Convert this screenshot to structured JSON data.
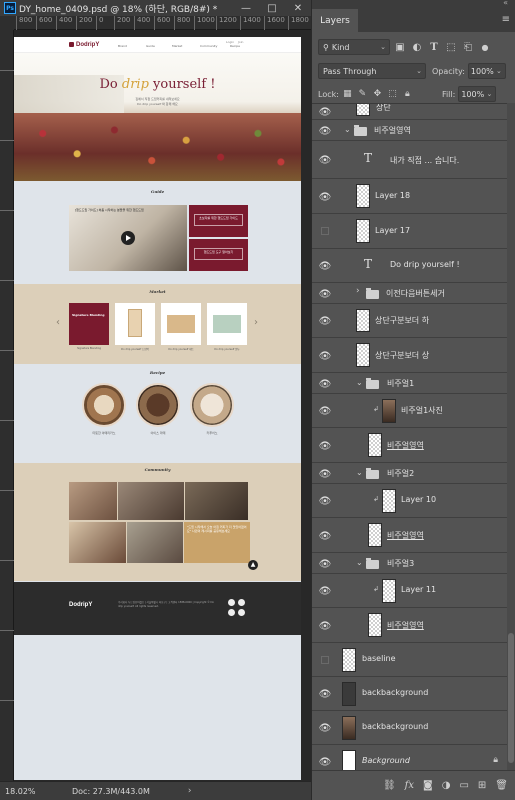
{
  "document": {
    "title": "DY_home_0409.psd @ 18% (하단, RGB/8#) *",
    "app_icon": "Ps",
    "window_buttons": [
      "—",
      "□",
      "✕"
    ],
    "ruler_ticks": [
      "800",
      "600",
      "400",
      "200",
      "0",
      "200",
      "400",
      "600",
      "800",
      "1000",
      "1200",
      "1400",
      "1600",
      "1800"
    ],
    "zoom": "18.02%",
    "doc_size": "Doc: 27.3M/443.0M"
  },
  "website": {
    "logo": "DodripY",
    "nav_items": [
      "Brand",
      "Guide",
      "Market",
      "Community",
      "Recipe"
    ],
    "nav_top": [
      "Login",
      "Join"
    ],
    "hero_title_prefix": "Do ",
    "hero_title_drip": "drip",
    "hero_title_suffix": " yourself !",
    "hero_sub_line1": "집에서 직접 드립커피를 내려보세요",
    "hero_sub_line2": "Do drip yourself 와 함께 해요",
    "section_guide": "Guide",
    "guide_video_text": "[핸드드립 가이드] 처음 시작하는 분들을 위한 핸드드립",
    "guide_card_1": "초보자를 위한 핸드드립 가이드",
    "guide_card_2": "핸드드립 도구 알아보기",
    "section_market": "Market",
    "product_captions": [
      "Signature Blending",
      "Do drip yourself 드립백",
      "Do drip yourself 세트",
      "Do drip yourself 원두"
    ],
    "product_1_label": "Signature Blending",
    "section_recipe": "Recipe",
    "recipe_captions": [
      "따뜻한 아메리카노",
      "아이스 라떼",
      "카푸치노"
    ],
    "section_community": "Community",
    "community_quote": "\"드립 시작해서 오늘 아침 커피가 더 맛있어졌어요\" 나만의 레시피를 공유해보세요",
    "top_button": "▲",
    "footer_logo": "DodripY",
    "footer_text": "주식회사 두드립유어셀프 | 서울특별시 마포구 | 고객센터 1588-0000 | Copyright © Do drip yourself. All rights reserved."
  },
  "layers_panel": {
    "collapse_icon": "«",
    "tab_label": "Layers",
    "menu_icon": "≡",
    "filter_kind": "Kind",
    "blend_mode": "Pass Through",
    "opacity_label": "Opacity:",
    "opacity_value": "100%",
    "lock_label": "Lock:",
    "fill_label": "Fill:",
    "fill_value": "100%",
    "layers": [
      {
        "name": "상단",
        "kind": "pixel",
        "visible": true
      },
      {
        "name": "비주얼영역",
        "kind": "group",
        "visible": true,
        "expanded": true
      },
      {
        "name": "내가 직접 ... 습니다.",
        "kind": "text",
        "visible": true
      },
      {
        "name": "Layer 18",
        "kind": "pixel",
        "visible": true
      },
      {
        "name": "Layer 17",
        "kind": "pixel",
        "visible": false
      },
      {
        "name": "Do drip yourself !",
        "kind": "text",
        "visible": true
      },
      {
        "name": "이전다음버튼세거",
        "kind": "group",
        "visible": true,
        "expanded": false
      },
      {
        "name": "상단구분보더 하",
        "kind": "pixel",
        "visible": true
      },
      {
        "name": "상단구분보더 상",
        "kind": "pixel",
        "visible": true
      },
      {
        "name": "비주얼1",
        "kind": "group",
        "visible": true,
        "expanded": true
      },
      {
        "name": "비주얼1사진",
        "kind": "photo",
        "visible": true,
        "clipped": true
      },
      {
        "name": "비주얼영역",
        "kind": "pixel",
        "visible": true,
        "underline": true
      },
      {
        "name": "비주얼2",
        "kind": "group",
        "visible": true,
        "expanded": true
      },
      {
        "name": "Layer 10",
        "kind": "photo",
        "visible": true,
        "clipped": true
      },
      {
        "name": "비주얼영역",
        "kind": "pixel",
        "visible": true,
        "underline": true
      },
      {
        "name": "비주얼3",
        "kind": "group",
        "visible": true,
        "expanded": true
      },
      {
        "name": "Layer 11",
        "kind": "photo",
        "visible": true,
        "clipped": true
      },
      {
        "name": "비주얼영역",
        "kind": "pixel",
        "visible": true,
        "underline": true
      },
      {
        "name": "baseline",
        "kind": "pixel",
        "visible": false
      },
      {
        "name": "backbackground",
        "kind": "pixel",
        "visible": true
      },
      {
        "name": "backbackground",
        "kind": "pixel",
        "visible": true
      },
      {
        "name": "Background",
        "kind": "background",
        "visible": true,
        "locked": true
      }
    ],
    "footer_icons": [
      "link-icon",
      "fx-icon",
      "mask-icon",
      "adjustment-icon",
      "folder-icon",
      "new-layer-icon",
      "trash-icon"
    ]
  }
}
